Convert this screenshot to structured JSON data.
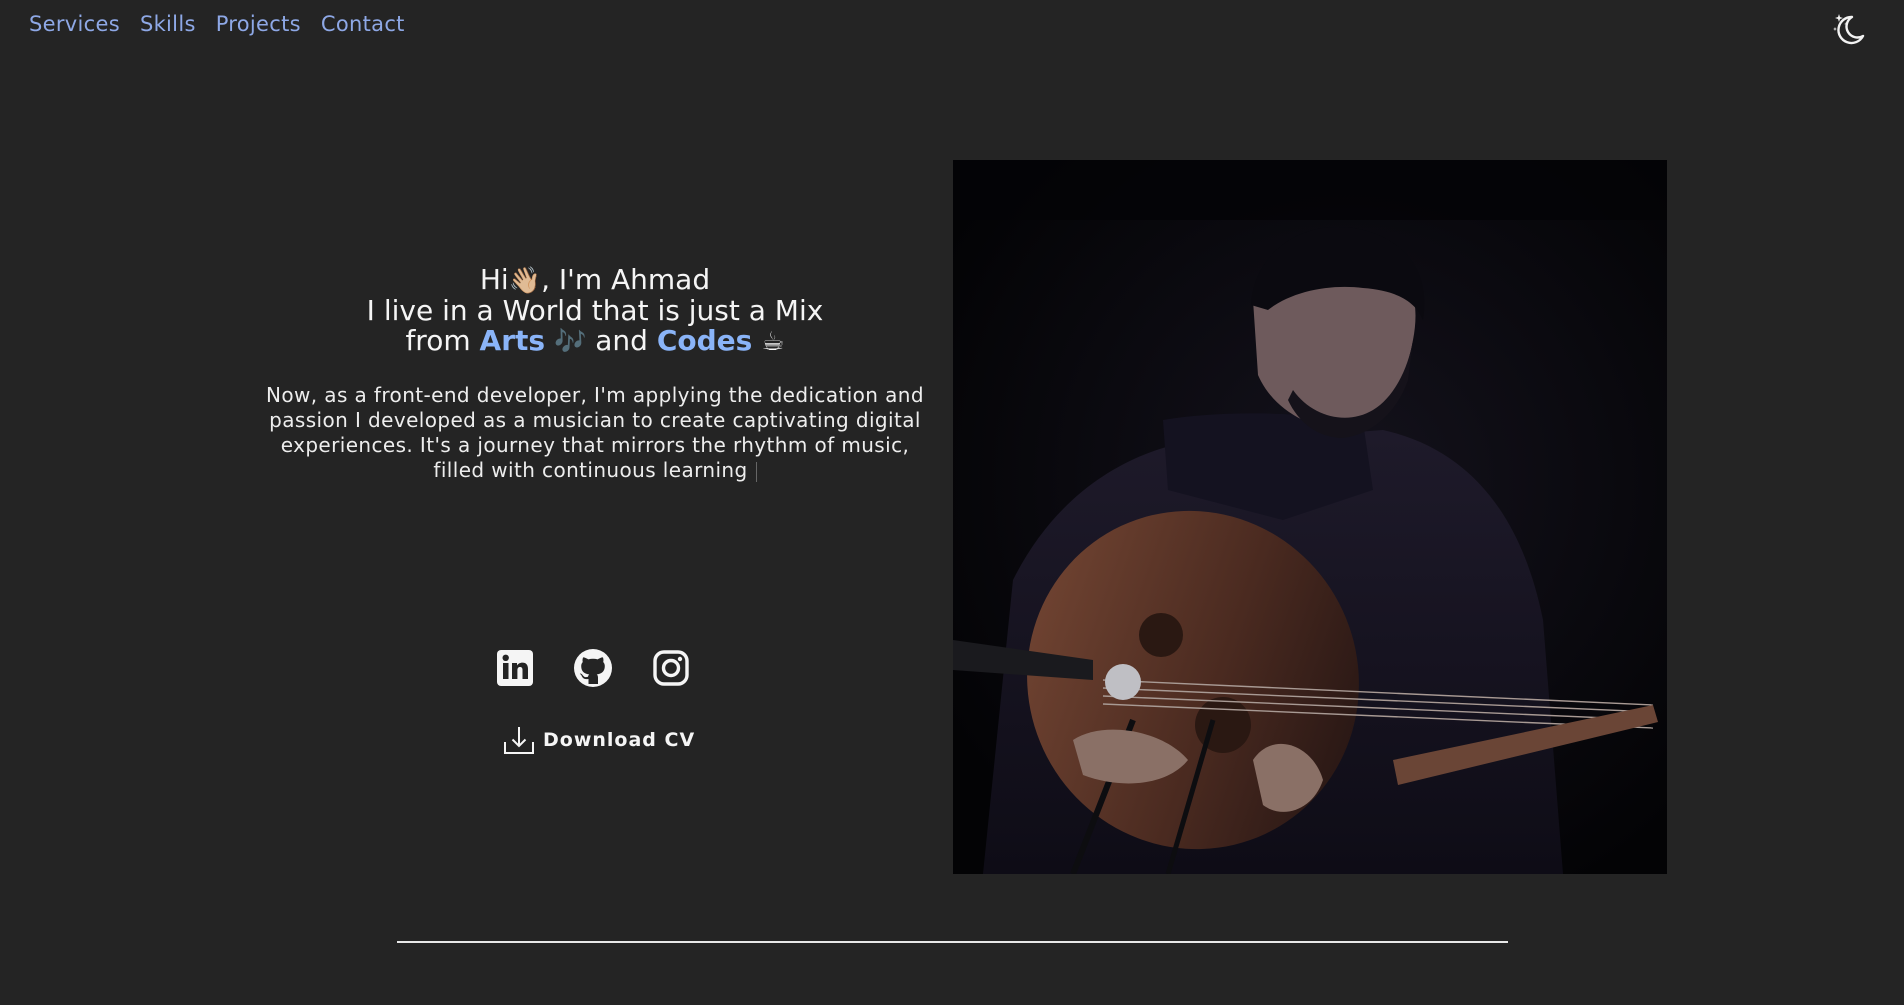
{
  "nav": {
    "items": [
      {
        "label": "Services"
      },
      {
        "label": "Skills"
      },
      {
        "label": "Projects"
      },
      {
        "label": "Contact"
      }
    ],
    "link_color": "#8ea8e6"
  },
  "theme_toggle": {
    "icon": "moon-stars-icon"
  },
  "hero": {
    "greeting_hi": "Hi",
    "greeting_wave": "👋🏼",
    "greeting_name": ", I'm Ahmad",
    "line2": "I live in a World that is just a Mix",
    "line3_from": "from",
    "arts": "Arts",
    "arts_emoji": "🎶",
    "and": "and",
    "codes": "Codes",
    "codes_emoji": "☕",
    "intro": "Now, as a front-end developer, I'm applying the dedication and passion I developed as a musician to create captivating digital experiences. It's a journey that mirrors the rhythm of music, filled with continuous learning",
    "accent_color": "#8ab4f8"
  },
  "socials": [
    {
      "icon": "linkedin-icon"
    },
    {
      "icon": "github-icon"
    },
    {
      "icon": "instagram-icon"
    }
  ],
  "download": {
    "label": "Download CV",
    "icon": "download-icon"
  },
  "photo": {
    "subject": "oud-player-photo"
  },
  "colors": {
    "background": "#242424",
    "text": "#f2f2f2",
    "divider": "#e8e8e8"
  }
}
